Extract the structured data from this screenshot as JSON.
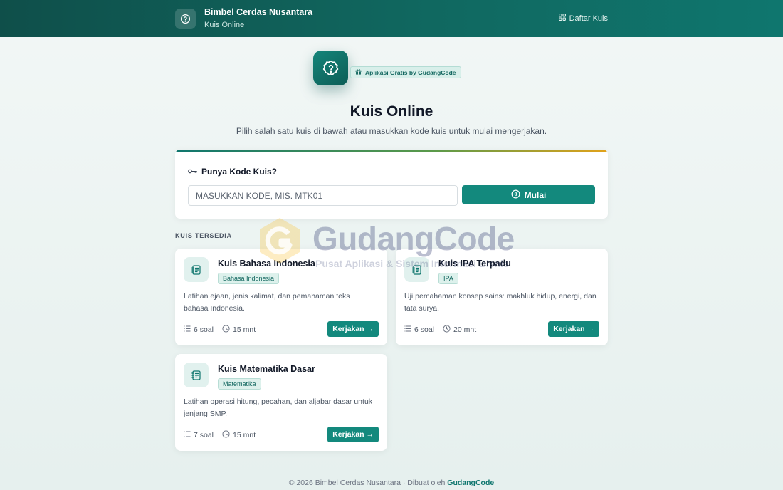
{
  "header": {
    "app_name": "Bimbel Cerdas Nusantara",
    "subtitle": "Kuis Online",
    "nav_label": "Daftar Kuis"
  },
  "hero": {
    "badge": "Aplikasi Gratis by GudangCode",
    "title": "Kuis Online",
    "subtitle": "Pilih salah satu kuis di bawah atau masukkan kode kuis untuk mulai mengerjakan."
  },
  "code_card": {
    "heading": "Punya Kode Kuis?",
    "placeholder": "MASUKKAN KODE, MIS. MTK01",
    "button_label": "Mulai"
  },
  "quizzes": {
    "section_label": "KUIS TERSEDIA",
    "items": [
      {
        "title": "Kuis Bahasa Indonesia",
        "tag": "Bahasa Indonesia",
        "description": "Latihan ejaan, jenis kalimat, dan pemahaman teks bahasa Indonesia.",
        "questions": "6 soal",
        "duration": "15 mnt",
        "button": "Kerjakan →"
      },
      {
        "title": "Kuis IPA Terpadu",
        "tag": "IPA",
        "description": "Uji pemahaman konsep sains: makhluk hidup, energi, dan tata surya.",
        "questions": "6 soal",
        "duration": "20 mnt",
        "button": "Kerjakan →"
      },
      {
        "title": "Kuis Matematika Dasar",
        "tag": "Matematika",
        "description": "Latihan operasi hitung, pecahan, dan aljabar dasar untuk jenjang SMP.",
        "questions": "7 soal",
        "duration": "15 mnt",
        "button": "Kerjakan →"
      }
    ]
  },
  "watermark": {
    "text": "GudangCode",
    "subtext": "Pusat Aplikasi & Sistem Informasi Bisnis"
  },
  "footer": {
    "text": "© 2026 Bimbel Cerdas Nusantara · Dibuat oleh",
    "brand": "GudangCode"
  },
  "colors": {
    "primary": "#13897d",
    "header_dark": "#0f4f4a",
    "accent_gold": "#e2a21a"
  }
}
